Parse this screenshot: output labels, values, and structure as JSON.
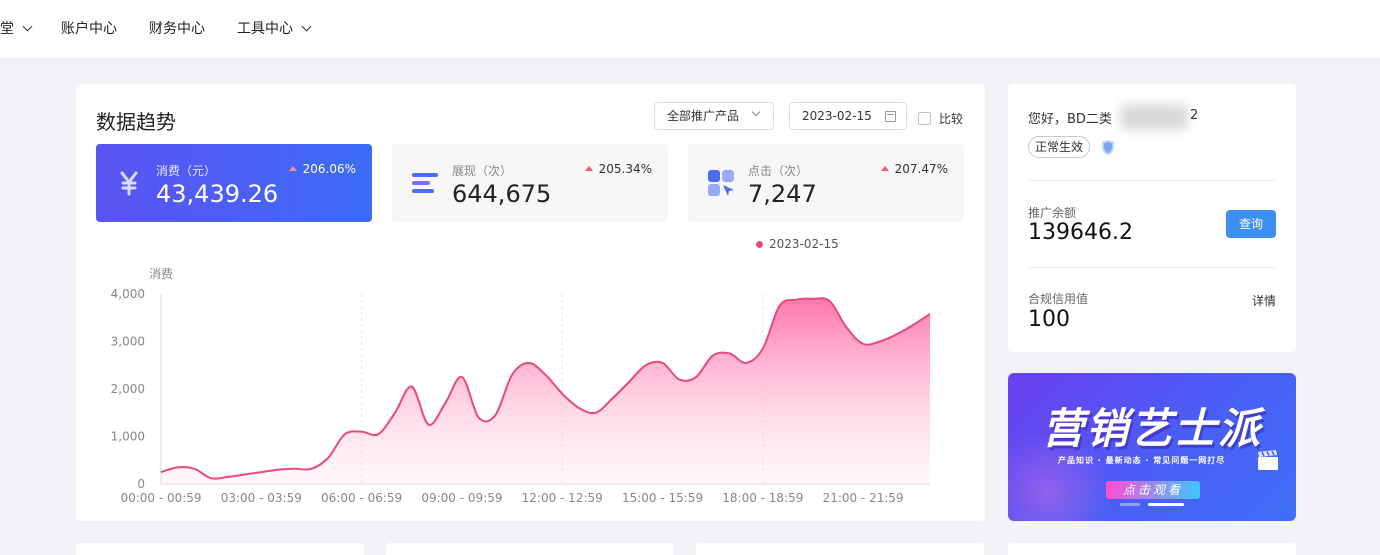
{
  "nav": {
    "items": [
      {
        "label": "堂",
        "dropdown": true
      },
      {
        "label": "账户中心",
        "dropdown": false
      },
      {
        "label": "财务中心",
        "dropdown": false
      },
      {
        "label": "工具中心",
        "dropdown": true
      }
    ]
  },
  "trend": {
    "title": "数据趋势",
    "product_select": "全部推广产品",
    "date": "2023-02-15",
    "compare_label": "比较",
    "compare_checked": false
  },
  "metrics": [
    {
      "label": "消费（元）",
      "value": "43,439.26",
      "change": "206.06%",
      "icon": "yuan-icon",
      "active": true
    },
    {
      "label": "展现（次）",
      "value": "644,675",
      "change": "205.34%",
      "icon": "bars-icon",
      "active": false
    },
    {
      "label": "点击（次）",
      "value": "7,247",
      "change": "207.47%",
      "icon": "click-grid-icon",
      "active": false
    }
  ],
  "chart_data": {
    "type": "area",
    "ylabel": "消费",
    "series": [
      {
        "name": "2023-02-15",
        "color": "#e8497f"
      }
    ],
    "ylim": [
      0,
      4000
    ],
    "yticks": [
      "0",
      "1,000",
      "2,000",
      "3,000",
      "4,000"
    ],
    "x_tick_labels": [
      "00:00 - 00:59",
      "03:00 - 03:59",
      "06:00 - 06:59",
      "09:00 - 09:59",
      "12:00 - 12:59",
      "15:00 - 15:59",
      "18:00 - 18:59",
      "21:00 - 21:59"
    ],
    "x": [
      0,
      0.5,
      1,
      1.5,
      2,
      2.5,
      3,
      3.5,
      4,
      4.5,
      5,
      5.5,
      6,
      6.5,
      7,
      7.5,
      8,
      8.5,
      9,
      9.5,
      10,
      10.5,
      11,
      11.5,
      12,
      12.5,
      13,
      13.5,
      14,
      14.5,
      15,
      15.5,
      16,
      16.5,
      17,
      17.5,
      18,
      18.5,
      19,
      19.5,
      20,
      20.5,
      21,
      21.5,
      22,
      22.5,
      23
    ],
    "values": [
      250,
      350,
      320,
      120,
      150,
      200,
      250,
      300,
      320,
      320,
      550,
      1050,
      1100,
      1050,
      1500,
      2050,
      1250,
      1700,
      2250,
      1400,
      1450,
      2300,
      2550,
      2300,
      1900,
      1600,
      1500,
      1800,
      2150,
      2500,
      2550,
      2200,
      2250,
      2700,
      2750,
      2550,
      2850,
      3750,
      3880,
      3900,
      3850,
      3300,
      2950,
      3000,
      3150,
      3350,
      3580
    ],
    "grid": "vertical-dashed",
    "legend_position": "top-right"
  },
  "account": {
    "greeting": "您好，BD二类",
    "greeting_tail": "2",
    "status": "正常生效",
    "balance_label": "推广余额",
    "balance_value": "139646.2",
    "query_label": "查询",
    "credit_label": "合规信用值",
    "credit_value": "100",
    "detail_label": "详情"
  },
  "banner": {
    "title": "营销艺士派",
    "subtitle": "产品知识 · 最新动态 · 常见问题一网打尽",
    "cta": "点击观看"
  },
  "colors": {
    "accent": "#3c6cf6",
    "chart_line": "#e8497f",
    "up": "#f25b6e"
  }
}
